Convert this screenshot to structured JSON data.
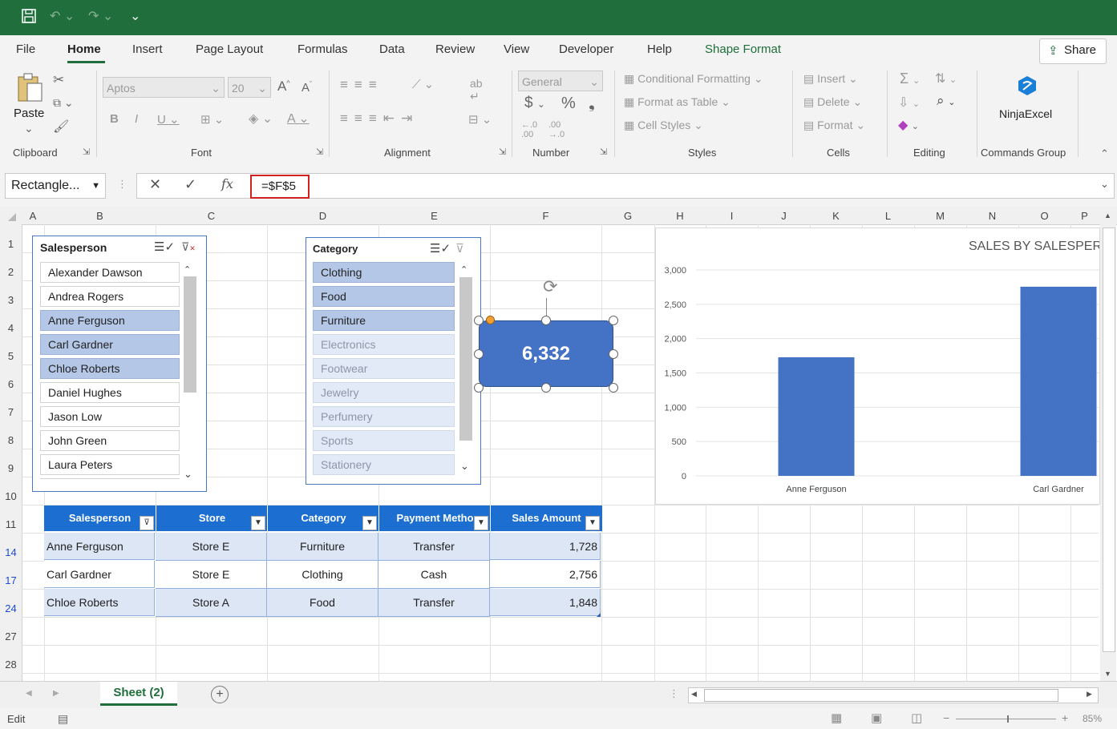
{
  "menu": {
    "file": "File",
    "home": "Home",
    "insert": "Insert",
    "page_layout": "Page Layout",
    "formulas": "Formulas",
    "data": "Data",
    "review": "Review",
    "view": "View",
    "developer": "Developer",
    "help": "Help",
    "shape_format": "Shape Format",
    "share": "Share"
  },
  "ribbon": {
    "paste": "Paste",
    "font_name": "Aptos",
    "font_size": "20",
    "number_format": "General",
    "conditional_formatting": "Conditional Formatting",
    "format_as_table": "Format as Table",
    "cell_styles": "Cell Styles",
    "insert": "Insert",
    "delete": "Delete",
    "format": "Format",
    "ninjaexcel": "NinjaExcel",
    "groups": {
      "clipboard": "Clipboard",
      "font": "Font",
      "alignment": "Alignment",
      "number": "Number",
      "styles": "Styles",
      "cells": "Cells",
      "editing": "Editing",
      "commands": "Commands Group"
    }
  },
  "formula_bar": {
    "name_box": "Rectangle...",
    "formula": "=$F$5"
  },
  "columns": [
    "A",
    "B",
    "C",
    "D",
    "E",
    "F",
    "G",
    "H",
    "I",
    "J",
    "K",
    "L",
    "M",
    "N",
    "O",
    "P"
  ],
  "rows": [
    "1",
    "2",
    "3",
    "4",
    "5",
    "6",
    "7",
    "8",
    "9",
    "10",
    "11",
    "14",
    "17",
    "24",
    "27",
    "28"
  ],
  "slicer_salesperson": {
    "title": "Salesperson",
    "items": [
      "Alexander Dawson",
      "Andrea Rogers",
      "Anne Ferguson",
      "Carl Gardner",
      "Chloe Roberts",
      "Daniel Hughes",
      "Jason Low",
      "John Green",
      "Laura Peters"
    ]
  },
  "slicer_category": {
    "title": "Category",
    "items": [
      "Clothing",
      "Food",
      "Furniture",
      "Electronics",
      "Footwear",
      "Jewelry",
      "Perfumery",
      "Sports",
      "Stationery"
    ]
  },
  "shape": {
    "value": "6,332"
  },
  "table": {
    "headers": [
      "Salesperson",
      "Store",
      "Category",
      "Payment Metho",
      "Sales Amount"
    ],
    "rows": [
      [
        "Anne Ferguson",
        "Store E",
        "Furniture",
        "Transfer",
        "1,728"
      ],
      [
        "Carl Gardner",
        "Store E",
        "Clothing",
        "Cash",
        "2,756"
      ],
      [
        "Chloe Roberts",
        "Store A",
        "Food",
        "Transfer",
        "1,848"
      ]
    ]
  },
  "chart_data": {
    "type": "bar",
    "title": "SALES BY SALESPERS",
    "categories": [
      "Anne Ferguson",
      "Carl Gardner"
    ],
    "values": [
      1728,
      2756
    ],
    "ylim": [
      0,
      3000
    ],
    "yticks": [
      "0",
      "500",
      "1,000",
      "1,500",
      "2,000",
      "2,500",
      "3,000"
    ],
    "grid": true,
    "color": "#4472c4"
  },
  "sheet_tab": "Sheet (2)",
  "status": {
    "mode": "Edit",
    "zoom": "85%"
  }
}
